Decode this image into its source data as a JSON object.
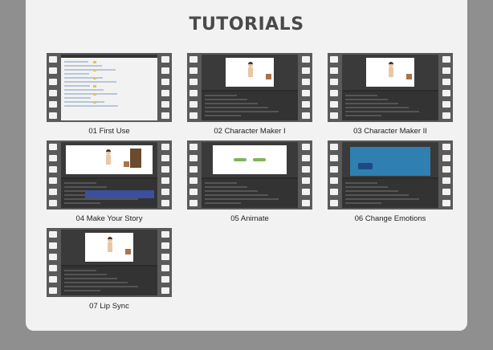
{
  "title": "TUTORIALS",
  "tutorials": [
    {
      "label": "01 First Use",
      "thumb": "file-explorer"
    },
    {
      "label": "02 Character Maker I",
      "thumb": "character-maker"
    },
    {
      "label": "03 Character Maker II",
      "thumb": "character-maker"
    },
    {
      "label": "04 Make Your Story",
      "thumb": "story"
    },
    {
      "label": "05 Animate",
      "thumb": "animate"
    },
    {
      "label": "06 Change Emotions",
      "thumb": "emotions"
    },
    {
      "label": "07 Lip Sync",
      "thumb": "character-maker"
    }
  ],
  "colors": {
    "background": "#8f8f8f",
    "panel": "#f2f2f2",
    "title": "#4a4a4a",
    "film": "#5a5a5a"
  }
}
